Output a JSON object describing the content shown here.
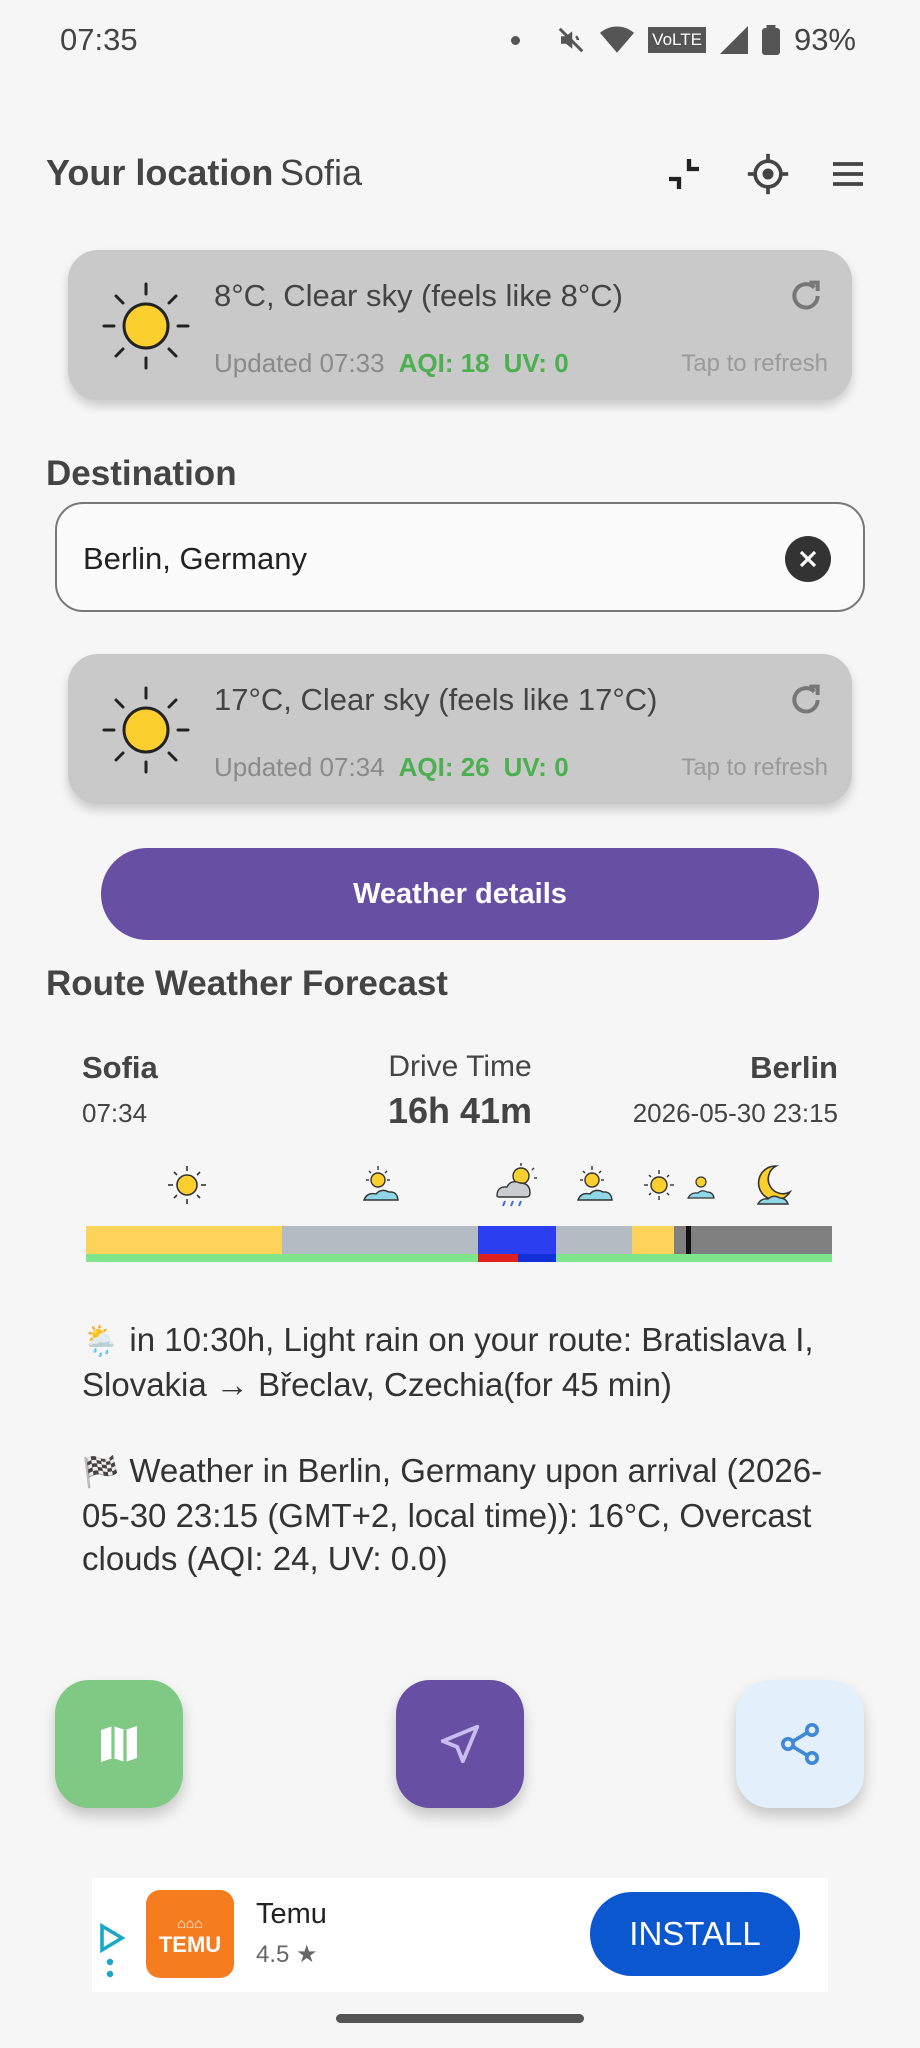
{
  "status_bar": {
    "time": "07:35",
    "battery": "93%",
    "network_badge": "VoLTE"
  },
  "header": {
    "label": "Your location",
    "location": "Sofia",
    "icons": [
      "collapse-icon",
      "my-location-icon",
      "menu-icon"
    ]
  },
  "origin_weather": {
    "condition": "8°C, Clear sky (feels like 8°C)",
    "updated": "Updated 07:33",
    "aqi": "AQI: 18",
    "uv": "UV: 0",
    "tap_hint": "Tap to refresh"
  },
  "destination": {
    "label": "Destination",
    "value": "Berlin, Germany"
  },
  "destination_weather": {
    "condition": "17°C, Clear sky (feels like 17°C)",
    "updated": "Updated 07:34",
    "aqi": "AQI: 26",
    "uv": "UV: 0",
    "tap_hint": "Tap to refresh"
  },
  "weather_details_button": "Weather details",
  "route": {
    "title": "Route Weather Forecast",
    "from_city": "Sofia",
    "from_time": "07:34",
    "drive_label": "Drive Time",
    "drive_value": "16h 41m",
    "to_city": "Berlin",
    "to_time": "2026-05-30 23:15",
    "timeline_icons": [
      "sun-icon",
      "partly-sunny-icon",
      "sun-rain-cloud-icon",
      "partly-sunny-icon",
      "sun-icon",
      "partly-sunny-icon",
      "moon-icon"
    ],
    "segment_colors": [
      "#fdd35a",
      "#b4bbc2",
      "#2b3ff0",
      "#b4bbc2",
      "#fdd35a",
      "#808080"
    ]
  },
  "forecast": {
    "rain_emoji": "🌦️",
    "rain_text": "in 10:30h, Light rain on your route: Bratislava I, Slovakia → Břeclav, Czechia(for 45 min)",
    "arrival_emoji": "🏁",
    "arrival_text": "Weather in Berlin, Germany upon arrival (2026-05-30 23:15 (GMT+2, local time)): 16°C, Overcast clouds (AQI: 24, UV: 0.0)"
  },
  "ad": {
    "app_name": "Temu",
    "logo_text": "TEMU",
    "rating": "4.5 ★",
    "install": "INSTALL"
  },
  "colors": {
    "accent": "#6750a4",
    "aqi_good": "#4caf50",
    "map_fab": "#7fc985",
    "share_fab": "#e3f0fb",
    "install": "#0b57d0"
  }
}
